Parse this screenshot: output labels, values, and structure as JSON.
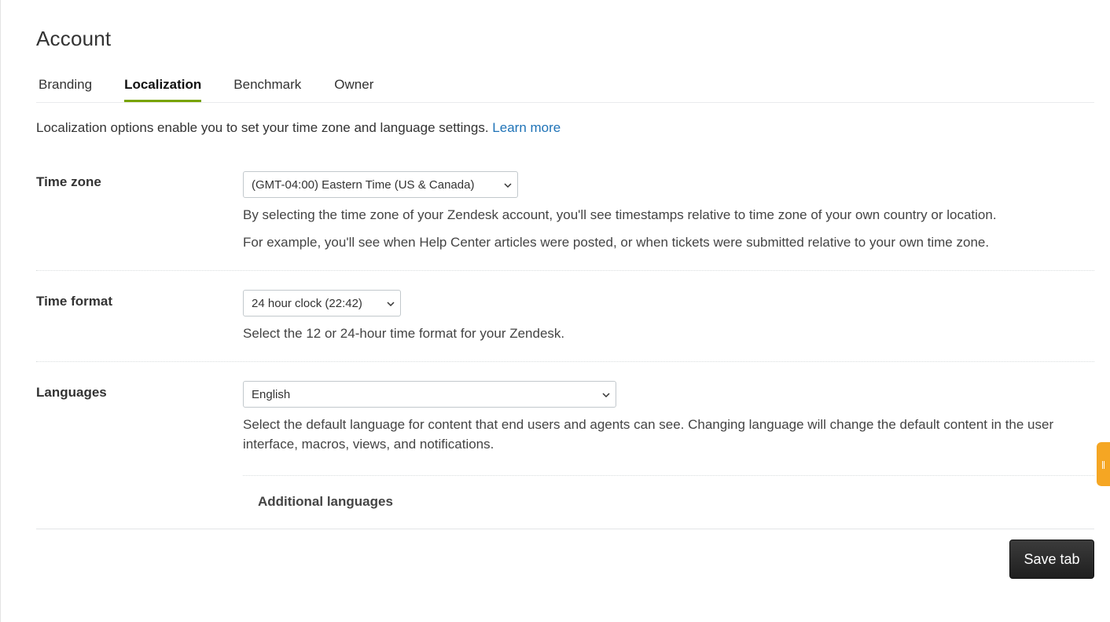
{
  "page": {
    "title": "Account"
  },
  "tabs": [
    {
      "label": "Branding",
      "active": false
    },
    {
      "label": "Localization",
      "active": true
    },
    {
      "label": "Benchmark",
      "active": false
    },
    {
      "label": "Owner",
      "active": false
    }
  ],
  "intro": {
    "text": "Localization options enable you to set your time zone and language settings.",
    "link": "Learn more"
  },
  "time_zone": {
    "label": "Time zone",
    "selected": "(GMT-04:00) Eastern Time (US & Canada)",
    "help1": "By selecting the time zone of your Zendesk account, you'll see timestamps relative to time zone of your own country or location.",
    "help2": "For example, you'll see when Help Center articles were posted, or when tickets were submitted relative to your own time zone."
  },
  "time_format": {
    "label": "Time format",
    "selected": "24 hour clock (22:42)",
    "help": "Select the 12 or 24-hour time format for your Zendesk."
  },
  "languages": {
    "label": "Languages",
    "selected": "English",
    "help": "Select the default language for content that end users and agents can see. Changing language will change the default content in the user interface, macros, views, and notifications.",
    "additional_label": "Additional languages"
  },
  "actions": {
    "save_label": "Save tab"
  },
  "colors": {
    "tab_accent": "#78a300",
    "link": "#1f73b7",
    "widget": "#f5a623",
    "button": "#2b2b2b"
  },
  "icons": {
    "select_arrow": "chevron-down-icon"
  }
}
